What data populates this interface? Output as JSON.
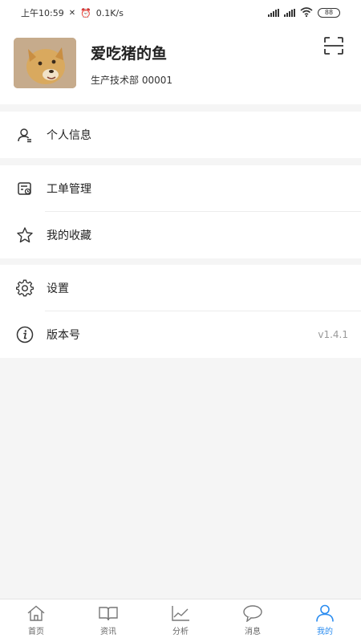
{
  "status_bar": {
    "time": "上午10:59",
    "speed": "0.1K/s",
    "battery": "88"
  },
  "profile": {
    "name": "爱吃猪的鱼",
    "department": "生产技术部 00001"
  },
  "menu": {
    "group1": [
      {
        "label": "个人信息",
        "icon": "user-icon"
      }
    ],
    "group2": [
      {
        "label": "工单管理",
        "icon": "work-order-icon"
      },
      {
        "label": "我的收藏",
        "icon": "star-icon"
      }
    ],
    "group3": [
      {
        "label": "设置",
        "icon": "gear-icon"
      },
      {
        "label": "版本号",
        "icon": "info-icon",
        "value": "v1.4.1"
      }
    ]
  },
  "tabs": [
    {
      "label": "首页",
      "icon": "home-icon"
    },
    {
      "label": "资讯",
      "icon": "book-icon"
    },
    {
      "label": "分析",
      "icon": "chart-icon"
    },
    {
      "label": "消息",
      "icon": "message-icon"
    },
    {
      "label": "我的",
      "icon": "user-icon",
      "active": true
    }
  ],
  "colors": {
    "accent": "#2a8cf0",
    "background": "#f5f5f5"
  }
}
